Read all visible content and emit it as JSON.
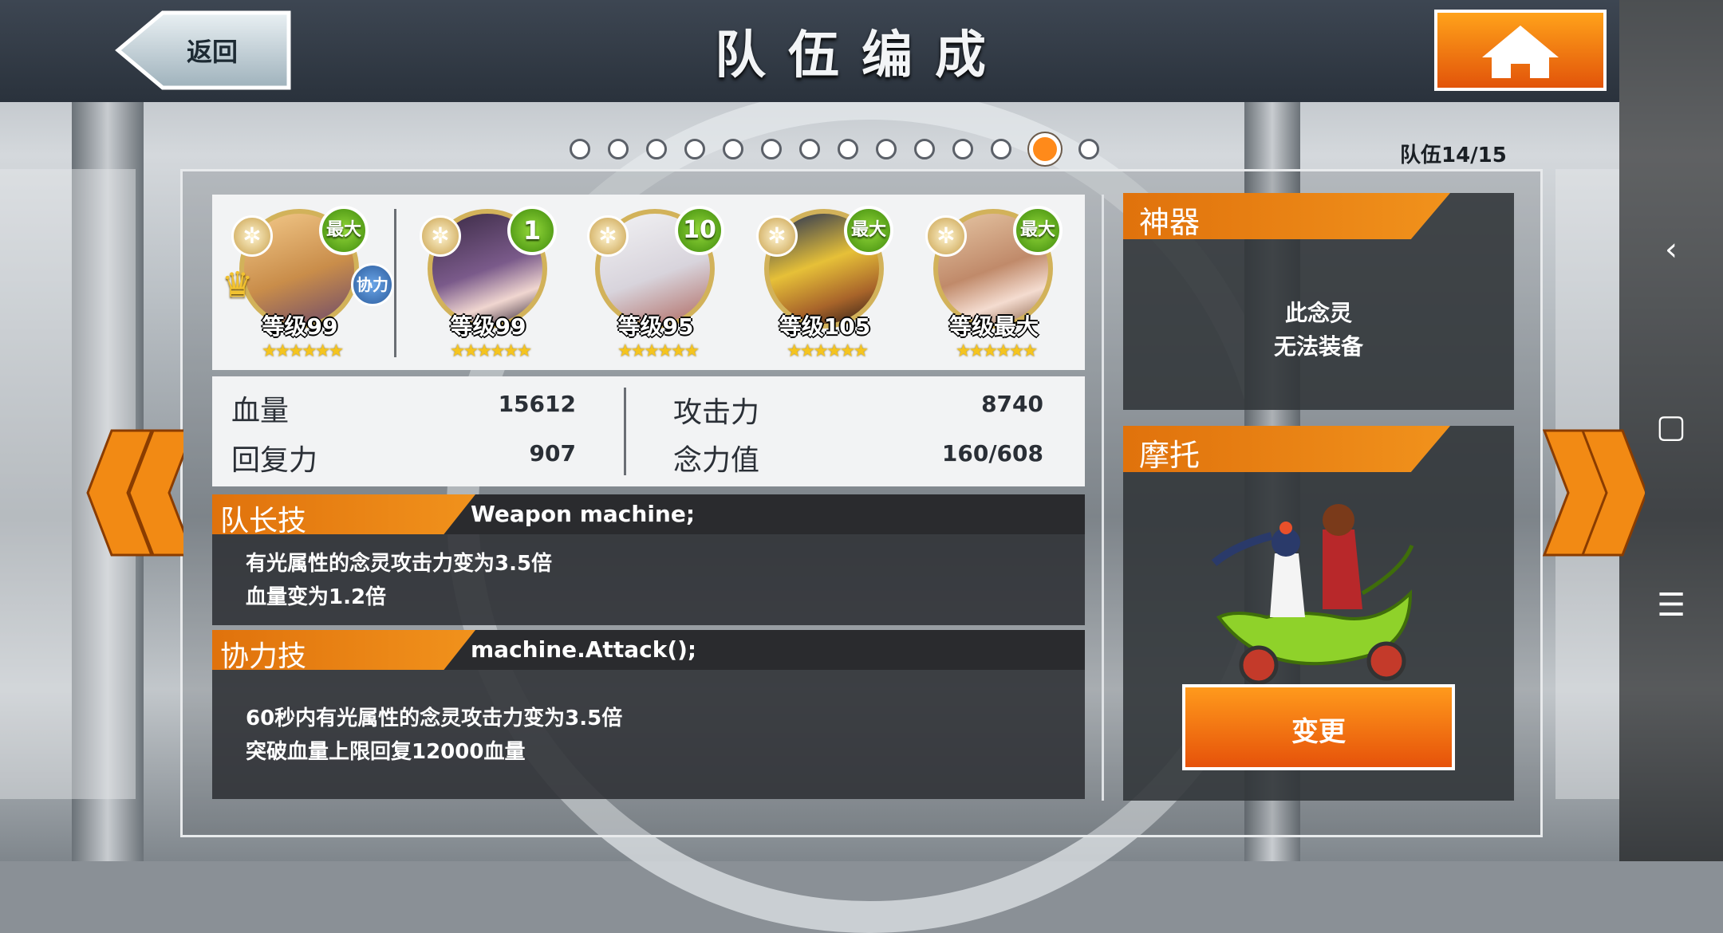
{
  "header": {
    "title": "队伍编成",
    "back_label": "返回"
  },
  "team_indicator": {
    "count_text": "队伍14/15",
    "total_pages": 15,
    "active_page": 14
  },
  "members": [
    {
      "level": "等级99",
      "badge": "最大",
      "stars": "★★★★★★",
      "leader": true,
      "coop": "协力"
    },
    {
      "level": "等级99",
      "badge": "1",
      "stars": "★★★★★★"
    },
    {
      "level": "等级95",
      "badge": "10",
      "stars": "★★★★★★"
    },
    {
      "level": "等级105",
      "badge": "最大",
      "stars": "★★★★★★"
    },
    {
      "level": "等级最大",
      "badge": "最大",
      "stars": "★★★★★★"
    }
  ],
  "stats": {
    "hp_label": "血量",
    "hp_value": "15612",
    "attack_label": "攻击力",
    "attack_value": "8740",
    "recovery_label": "回复力",
    "recovery_value": "907",
    "mind_label": "念力值",
    "mind_value": "160/608"
  },
  "leader_skill": {
    "tag": "队长技",
    "name": "Weapon machine;",
    "desc_line1": "有光属性的念灵攻击力变为3.5倍",
    "desc_line2": "血量变为1.2倍"
  },
  "coop_skill": {
    "tag": "协力技",
    "name": "machine.Attack();",
    "desc_line1": "60秒内有光属性的念灵攻击力变为3.5倍",
    "desc_line2": "突破血量上限回复12000血量"
  },
  "artifact": {
    "title": "神器",
    "msg_line1": "此念灵",
    "msg_line2": "无法装备"
  },
  "moto": {
    "title": "摩托",
    "change_label": "变更"
  },
  "colors": {
    "accent": "#f1921c",
    "level_badge": "#5fae1f",
    "star": "#f5c41e"
  }
}
